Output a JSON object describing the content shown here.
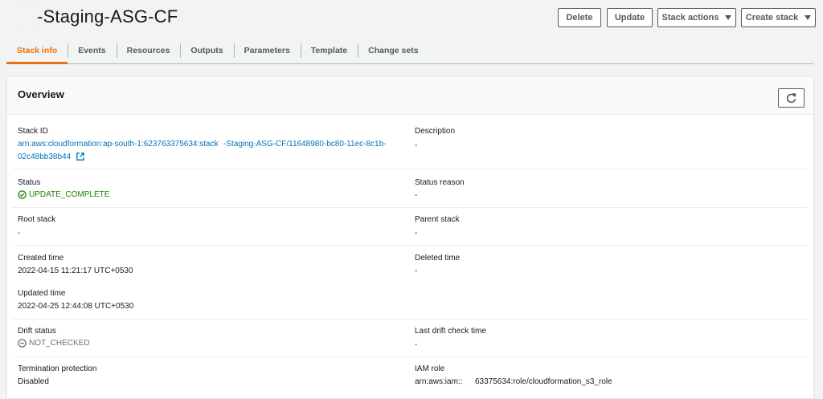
{
  "header": {
    "stack_title": "-Staging-ASG-CF",
    "buttons": {
      "delete": "Delete",
      "update": "Update",
      "stack_actions": "Stack actions",
      "create_stack": "Create stack"
    }
  },
  "tabs": [
    {
      "label": "Stack info",
      "active": true
    },
    {
      "label": "Events"
    },
    {
      "label": "Resources"
    },
    {
      "label": "Outputs"
    },
    {
      "label": "Parameters"
    },
    {
      "label": "Template"
    },
    {
      "label": "Change sets"
    }
  ],
  "overview": {
    "title": "Overview",
    "stack_id": {
      "label": "Stack ID",
      "value_part1": "arn:aws:cloudformation:ap-south-1:623763375634:stack",
      "value_part2": "-Staging-ASG-CF/11648980-bc80-11ec-8c1b-",
      "value_part3": "02c48bb38b44"
    },
    "description": {
      "label": "Description",
      "value": "-"
    },
    "status": {
      "label": "Status",
      "value": "UPDATE_COMPLETE"
    },
    "status_reason": {
      "label": "Status reason",
      "value": "-"
    },
    "root_stack": {
      "label": "Root stack",
      "value": "-"
    },
    "parent_stack": {
      "label": "Parent stack",
      "value": "-"
    },
    "created_time": {
      "label": "Created time",
      "value": "2022-04-15 11:21:17 UTC+0530"
    },
    "deleted_time": {
      "label": "Deleted time",
      "value": "-"
    },
    "updated_time": {
      "label": "Updated time",
      "value": "2022-04-25 12:44:08 UTC+0530"
    },
    "drift_status": {
      "label": "Drift status",
      "value": "NOT_CHECKED"
    },
    "last_drift_check": {
      "label": "Last drift check time",
      "value": "-"
    },
    "termination_protection": {
      "label": "Termination protection",
      "value": "Disabled"
    },
    "iam_role": {
      "label": "IAM role",
      "value_part1": "arn:aws:iam::",
      "value_part2": "63375634:role/cloudformation_s3_role"
    }
  },
  "colors": {
    "accent": "#ec7211",
    "link": "#0073bb",
    "success": "#1d8102",
    "muted": "#687078"
  },
  "icons": {
    "refresh": "refresh-icon",
    "external_link": "external-link-icon",
    "status_ok": "check-circle-icon",
    "status_none": "minus-circle-icon",
    "dropdown": "caret-down-icon"
  }
}
